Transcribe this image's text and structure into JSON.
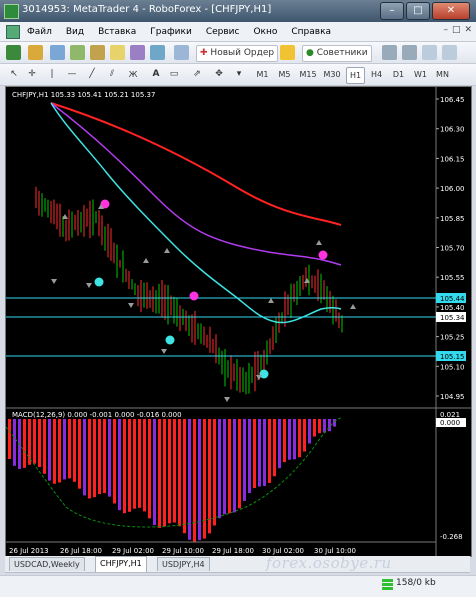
{
  "window": {
    "title": "3014953: MetaTrader 4 - RoboForex - [CHFJPY,H1]",
    "minimize": "–",
    "maximize": "□",
    "close": "✕"
  },
  "menu": {
    "items": [
      "Файл",
      "Вид",
      "Вставка",
      "Графики",
      "Сервис",
      "Окно",
      "Справка"
    ],
    "mdi": [
      "–",
      "□",
      "✕"
    ]
  },
  "toolbar1": {
    "new_order": "Новый Ордер",
    "experts": "Советники"
  },
  "toolbar2": {
    "timeframes": [
      "M1",
      "M5",
      "M15",
      "M30",
      "H1",
      "H4",
      "D1",
      "W1",
      "MN"
    ],
    "active": "H1"
  },
  "chart": {
    "header": "CHFJPY,H1  105.33 105.41 105.21 105.37",
    "price_labels": [
      "106.45",
      "106.30",
      "106.15",
      "106.00",
      "105.85",
      "105.70",
      "105.55",
      "105.40",
      "105.25",
      "105.10",
      "104.95"
    ],
    "line_labels": [
      "105.44",
      "105.34",
      "105.15"
    ],
    "macd_header": "MACD(12,26,9) 0.000 -0.001 0.000 -0.016 0.000",
    "macd_labels": [
      "0.021",
      "0.000",
      "-0.268"
    ],
    "time_labels": [
      "26 Jul 2013",
      "26 Jul 18:00",
      "29 Jul 02:00",
      "29 Jul 10:00",
      "29 Jul 18:00",
      "30 Jul 02:00",
      "30 Jul 10:00"
    ],
    "colors": {
      "up": "#00c800",
      "down": "#ff2b2b",
      "ma_red": "#ff2222",
      "ma_violet": "#b23cf0",
      "ma_cyan": "#3fe3e3",
      "hline": "#33d9ec",
      "macd_red": "#ff2020",
      "macd_violet": "#8a2be2",
      "signal": "#0a8f0a"
    }
  },
  "tabs": [
    "USDCAD,Weekly",
    "CHFJPY,H1",
    "USDJPY,H4"
  ],
  "active_tab": "CHFJPY,H1",
  "watermark": "forex.osobye.ru",
  "status": {
    "traffic": "158/0 kb"
  }
}
